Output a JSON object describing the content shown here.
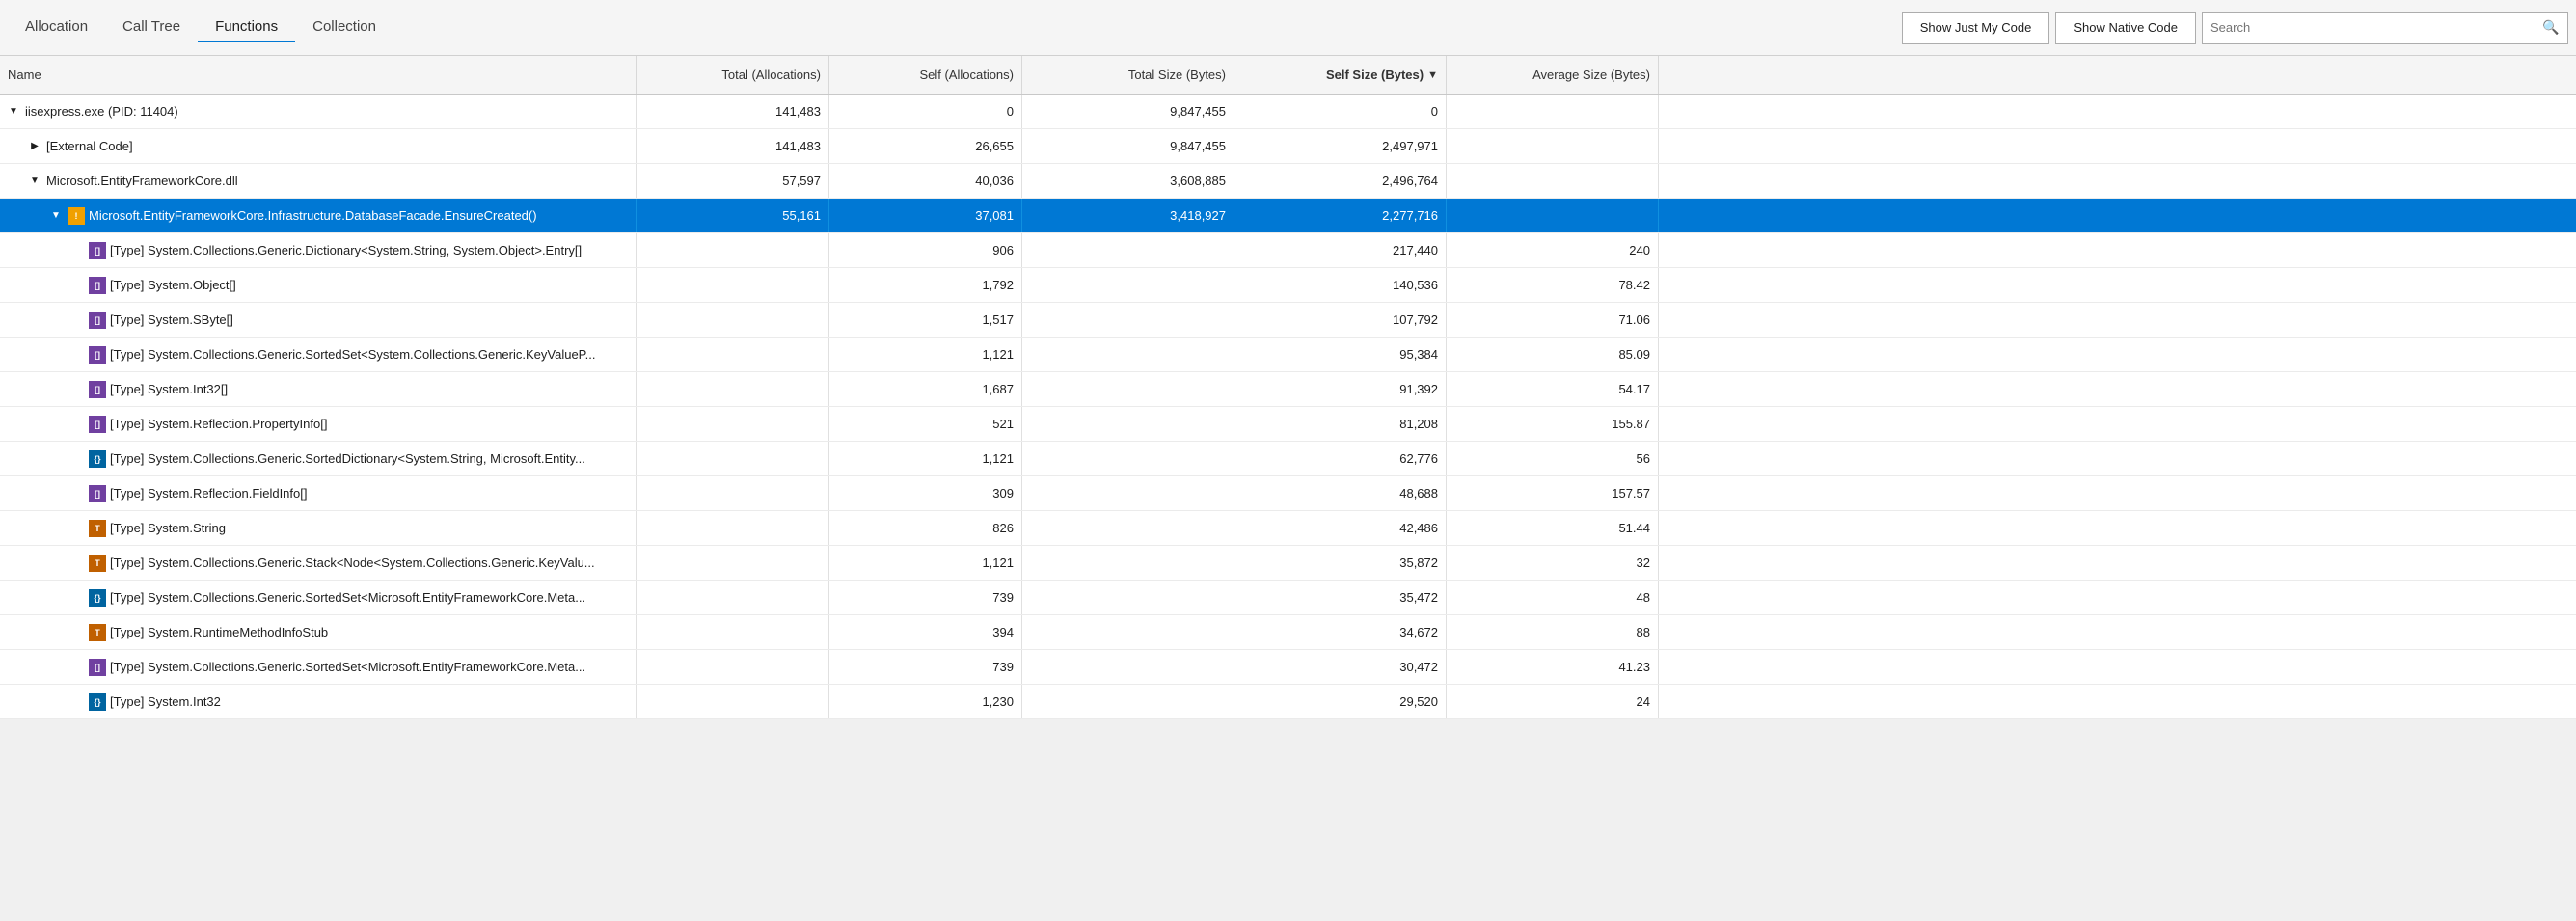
{
  "tabs": [
    {
      "id": "allocation",
      "label": "Allocation",
      "active": false
    },
    {
      "id": "calltree",
      "label": "Call Tree",
      "active": false
    },
    {
      "id": "functions",
      "label": "Functions",
      "active": true
    },
    {
      "id": "collection",
      "label": "Collection",
      "active": false
    }
  ],
  "toolbar": {
    "show_just_my_code": "Show Just My Code",
    "show_native_code": "Show Native Code",
    "search_placeholder": "Search"
  },
  "columns": [
    {
      "id": "name",
      "label": "Name",
      "align": "left"
    },
    {
      "id": "total_alloc",
      "label": "Total (Allocations)",
      "align": "right"
    },
    {
      "id": "self_alloc",
      "label": "Self (Allocations)",
      "align": "right"
    },
    {
      "id": "total_size",
      "label": "Total Size (Bytes)",
      "align": "right"
    },
    {
      "id": "self_size",
      "label": "Self Size (Bytes)",
      "align": "right",
      "sort": "desc"
    },
    {
      "id": "avg_size",
      "label": "Average Size (Bytes)",
      "align": "right"
    }
  ],
  "rows": [
    {
      "id": "r1",
      "indent": 0,
      "expander": "▼",
      "icon": null,
      "name": "iisexpress.exe (PID: 11404)",
      "total_alloc": "141,483",
      "self_alloc": "0",
      "total_size": "9,847,455",
      "self_size": "0",
      "avg_size": "",
      "selected": false
    },
    {
      "id": "r2",
      "indent": 1,
      "expander": "▶",
      "icon": null,
      "name": "[External Code]",
      "total_alloc": "141,483",
      "self_alloc": "26,655",
      "total_size": "9,847,455",
      "self_size": "2,497,971",
      "avg_size": "",
      "selected": false
    },
    {
      "id": "r3",
      "indent": 1,
      "expander": "▼",
      "icon": null,
      "name": "Microsoft.EntityFrameworkCore.dll",
      "total_alloc": "57,597",
      "self_alloc": "40,036",
      "total_size": "3,608,885",
      "self_size": "2,496,764",
      "avg_size": "",
      "selected": false
    },
    {
      "id": "r4",
      "indent": 2,
      "expander": "▼",
      "icon": "warning",
      "name": "Microsoft.EntityFrameworkCore.Infrastructure.DatabaseFacade.EnsureCreated()",
      "total_alloc": "55,161",
      "self_alloc": "37,081",
      "total_size": "3,418,927",
      "self_size": "2,277,716",
      "avg_size": "",
      "selected": true
    },
    {
      "id": "r5",
      "indent": 3,
      "expander": null,
      "icon": "purple",
      "name": "[Type] System.Collections.Generic.Dictionary<System.String, System.Object>.Entry[]",
      "total_alloc": "",
      "self_alloc": "906",
      "total_size": "",
      "self_size": "217,440",
      "avg_size": "240",
      "selected": false
    },
    {
      "id": "r6",
      "indent": 3,
      "expander": null,
      "icon": "purple",
      "name": "[Type] System.Object[]",
      "total_alloc": "",
      "self_alloc": "1,792",
      "total_size": "",
      "self_size": "140,536",
      "avg_size": "78.42",
      "selected": false
    },
    {
      "id": "r7",
      "indent": 3,
      "expander": null,
      "icon": "purple",
      "name": "[Type] System.SByte[]",
      "total_alloc": "",
      "self_alloc": "1,517",
      "total_size": "",
      "self_size": "107,792",
      "avg_size": "71.06",
      "selected": false
    },
    {
      "id": "r8",
      "indent": 3,
      "expander": null,
      "icon": "purple",
      "name": "[Type] System.Collections.Generic.SortedSet<System.Collections.Generic.KeyValueP...",
      "total_alloc": "",
      "self_alloc": "1,121",
      "total_size": "",
      "self_size": "95,384",
      "avg_size": "85.09",
      "selected": false
    },
    {
      "id": "r9",
      "indent": 3,
      "expander": null,
      "icon": "purple",
      "name": "[Type] System.Int32[]",
      "total_alloc": "",
      "self_alloc": "1,687",
      "total_size": "",
      "self_size": "91,392",
      "avg_size": "54.17",
      "selected": false
    },
    {
      "id": "r10",
      "indent": 3,
      "expander": null,
      "icon": "purple",
      "name": "[Type] System.Reflection.PropertyInfo[]",
      "total_alloc": "",
      "self_alloc": "521",
      "total_size": "",
      "self_size": "81,208",
      "avg_size": "155.87",
      "selected": false
    },
    {
      "id": "r11",
      "indent": 3,
      "expander": null,
      "icon": "blue",
      "name": "[Type] System.Collections.Generic.SortedDictionary<System.String, Microsoft.Entity...",
      "total_alloc": "",
      "self_alloc": "1,121",
      "total_size": "",
      "self_size": "62,776",
      "avg_size": "56",
      "selected": false
    },
    {
      "id": "r12",
      "indent": 3,
      "expander": null,
      "icon": "purple",
      "name": "[Type] System.Reflection.FieldInfo[]",
      "total_alloc": "",
      "self_alloc": "309",
      "total_size": "",
      "self_size": "48,688",
      "avg_size": "157.57",
      "selected": false
    },
    {
      "id": "r13",
      "indent": 3,
      "expander": null,
      "icon": "orange",
      "name": "[Type] System.String",
      "total_alloc": "",
      "self_alloc": "826",
      "total_size": "",
      "self_size": "42,486",
      "avg_size": "51.44",
      "selected": false
    },
    {
      "id": "r14",
      "indent": 3,
      "expander": null,
      "icon": "orange",
      "name": "[Type] System.Collections.Generic.Stack<Node<System.Collections.Generic.KeyValu...",
      "total_alloc": "",
      "self_alloc": "1,121",
      "total_size": "",
      "self_size": "35,872",
      "avg_size": "32",
      "selected": false
    },
    {
      "id": "r15",
      "indent": 3,
      "expander": null,
      "icon": "blue",
      "name": "[Type] System.Collections.Generic.SortedSet<Microsoft.EntityFrameworkCore.Meta...",
      "total_alloc": "",
      "self_alloc": "739",
      "total_size": "",
      "self_size": "35,472",
      "avg_size": "48",
      "selected": false
    },
    {
      "id": "r16",
      "indent": 3,
      "expander": null,
      "icon": "orange",
      "name": "[Type] System.RuntimeMethodInfoStub",
      "total_alloc": "",
      "self_alloc": "394",
      "total_size": "",
      "self_size": "34,672",
      "avg_size": "88",
      "selected": false
    },
    {
      "id": "r17",
      "indent": 3,
      "expander": null,
      "icon": "purple",
      "name": "[Type] System.Collections.Generic.SortedSet<Microsoft.EntityFrameworkCore.Meta...",
      "total_alloc": "",
      "self_alloc": "739",
      "total_size": "",
      "self_size": "30,472",
      "avg_size": "41.23",
      "selected": false
    },
    {
      "id": "r18",
      "indent": 3,
      "expander": null,
      "icon": "blue",
      "name": "[Type] System.Int32",
      "total_alloc": "",
      "self_alloc": "1,230",
      "total_size": "",
      "self_size": "29,520",
      "avg_size": "24",
      "selected": false
    }
  ]
}
